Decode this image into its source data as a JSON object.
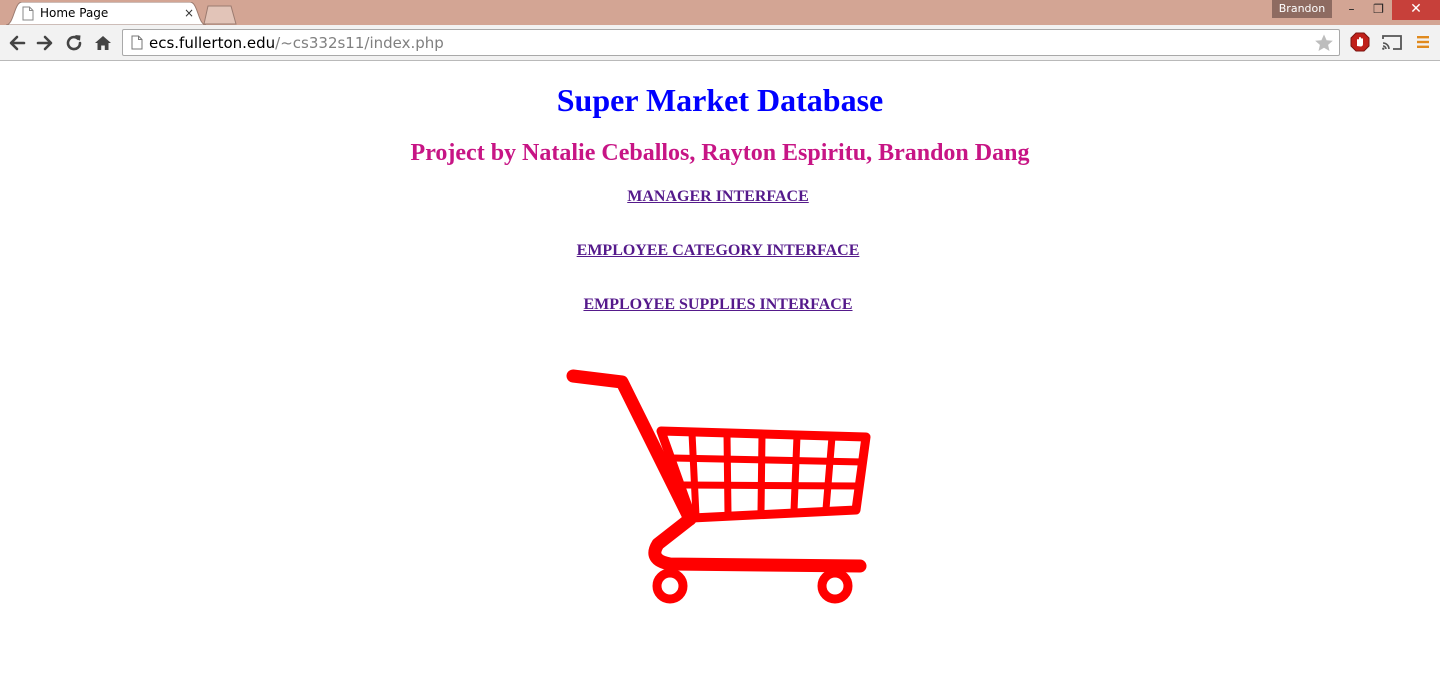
{
  "browser": {
    "tab_title": "Home Page",
    "tab_close": "×",
    "profile_name": "Brandon",
    "window_controls": {
      "minimize": "–",
      "restore": "❐",
      "close": "✕"
    },
    "url_host": "ecs.fullerton.edu",
    "url_path": "/~cs332s11/index.php",
    "icons": [
      "page-icon",
      "back-icon",
      "forward-icon",
      "reload-icon",
      "home-icon",
      "star-icon",
      "adblock-icon",
      "cast-icon",
      "menu-icon"
    ]
  },
  "page": {
    "title": "Super Market Database",
    "subtitle": "Project by Natalie Ceballos, Rayton Espiritu, Brandon Dang",
    "links": [
      {
        "label": "MANAGER INTERFACE"
      },
      {
        "label": "EMPLOYEE CATEGORY INTERFACE"
      },
      {
        "label": "EMPLOYEE SUPPLIES INTERFACE"
      }
    ],
    "image": "shopping-cart"
  },
  "colors": {
    "title": "#0000ff",
    "subtitle": "#c71585",
    "visited_link": "#551a8b",
    "cart": "#ff0000",
    "titlebar": "#d3a594",
    "close_button": "#c7403a"
  }
}
